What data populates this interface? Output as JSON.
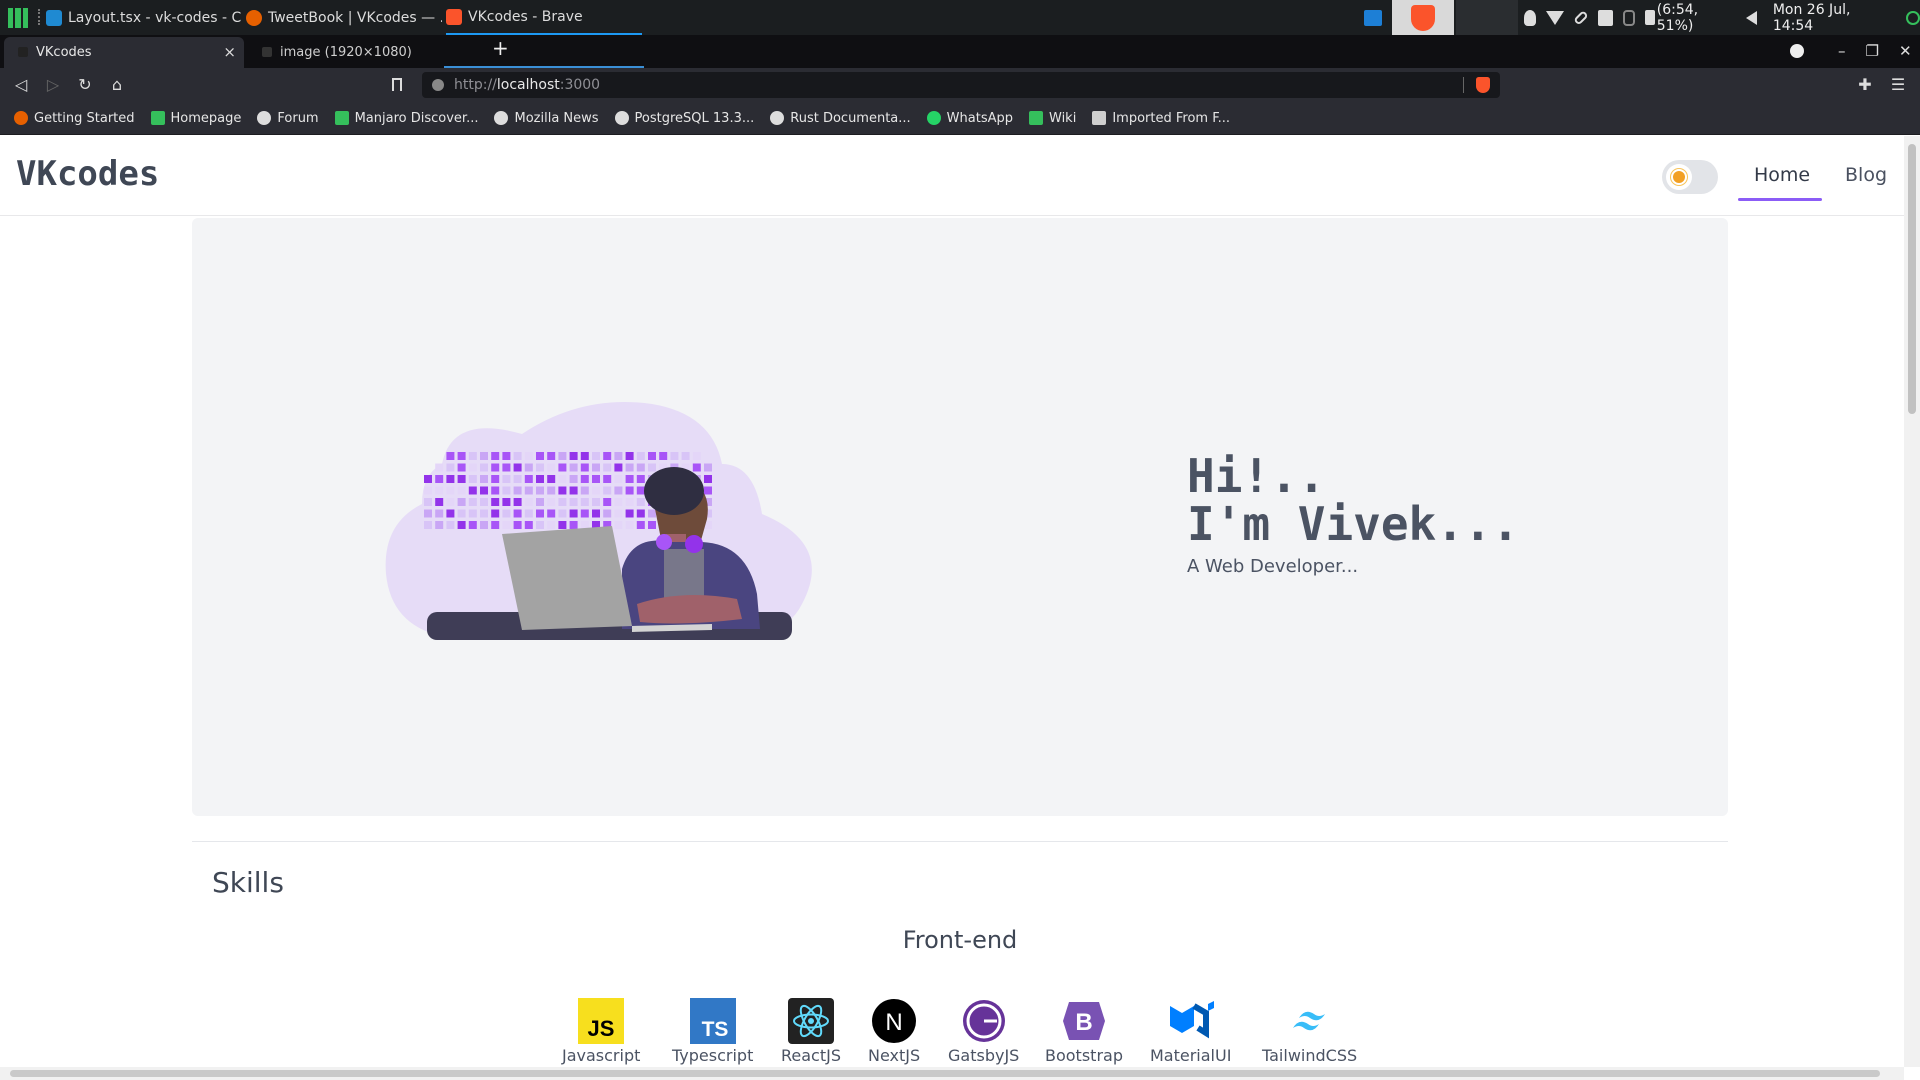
{
  "system_panel": {
    "tasks": [
      {
        "label": "Layout.tsx - vk-codes - Co...",
        "icon": "vscode-icon"
      },
      {
        "label": "TweetBook | VKcodes — ...",
        "icon": "firefox-icon"
      },
      {
        "label": "VKcodes - Brave",
        "icon": "brave-icon"
      }
    ],
    "battery": "(6:54, 51%)",
    "clock": "Mon 26 Jul, 14:54"
  },
  "browser": {
    "tabs": [
      {
        "label": "VKcodes"
      },
      {
        "label": "image (1920×1080)"
      }
    ],
    "url_scheme": "http://",
    "url_host": "localhost",
    "url_port": ":3000",
    "bookmarks": [
      {
        "label": "Getting Started",
        "icon": "firefox-icon",
        "color": "#e66000"
      },
      {
        "label": "Homepage",
        "icon": "manjaro-icon",
        "color": "#35bf5c"
      },
      {
        "label": "Forum",
        "icon": "globe-icon",
        "color": "#dddddd"
      },
      {
        "label": "Manjaro Discover...",
        "icon": "manjaro-icon",
        "color": "#35bf5c"
      },
      {
        "label": "Mozilla News",
        "icon": "globe-icon",
        "color": "#dddddd"
      },
      {
        "label": "PostgreSQL 13.3...",
        "icon": "globe-icon",
        "color": "#dddddd"
      },
      {
        "label": "Rust Documenta...",
        "icon": "globe-icon",
        "color": "#dddddd"
      },
      {
        "label": "WhatsApp",
        "icon": "whatsapp-icon",
        "color": "#25d366"
      },
      {
        "label": "Wiki",
        "icon": "manjaro-icon",
        "color": "#35bf5c"
      },
      {
        "label": "Imported From F...",
        "icon": "folder-icon",
        "color": "#cfcfcf"
      }
    ]
  },
  "site": {
    "brand": "VKcodes",
    "nav": [
      {
        "label": "Home",
        "active": true
      },
      {
        "label": "Blog",
        "active": false
      }
    ],
    "hero": {
      "line1": "Hi!..",
      "line2": "I'm Vivek...",
      "subtitle": "A Web Developer..."
    },
    "skills_title": "Skills",
    "frontend_title": "Front-end",
    "skills": [
      {
        "label": "Javascript",
        "icon": "javascript-icon",
        "color": "#f7df1e"
      },
      {
        "label": "Typescript",
        "icon": "typescript-icon",
        "color": "#3178c6"
      },
      {
        "label": "ReactJS",
        "icon": "react-icon",
        "color": "#61dafb"
      },
      {
        "label": "NextJS",
        "icon": "nextjs-icon",
        "color": "#000000"
      },
      {
        "label": "GatsbyJS",
        "icon": "gatsby-icon",
        "color": "#663399"
      },
      {
        "label": "Bootstrap",
        "icon": "bootstrap-icon",
        "color": "#7952b3"
      },
      {
        "label": "MaterialUI",
        "icon": "materialui-icon",
        "color": "#007fff"
      },
      {
        "label": "TailwindCSS",
        "icon": "tailwind-icon",
        "color": "#38bdf8"
      }
    ]
  },
  "colors": {
    "accent": "#8b5cf6",
    "hero_bg": "#f3f4f6",
    "text": "#4b5363"
  }
}
